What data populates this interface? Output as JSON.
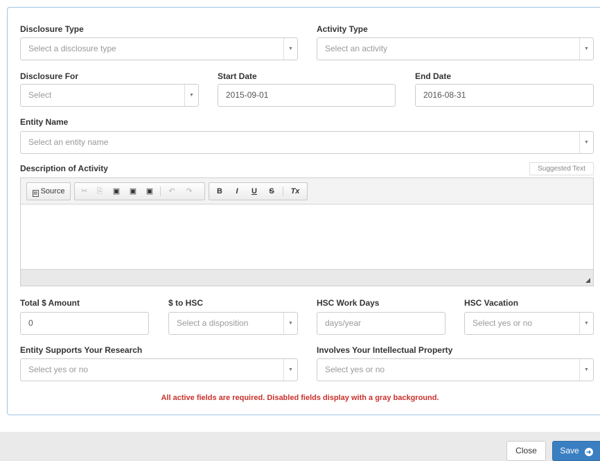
{
  "form": {
    "disclosure_type": {
      "label": "Disclosure Type",
      "placeholder": "Select a disclosure type"
    },
    "activity_type": {
      "label": "Activity Type",
      "placeholder": "Select an activity"
    },
    "disclosure_for": {
      "label": "Disclosure For",
      "placeholder": "Select"
    },
    "start_date": {
      "label": "Start Date",
      "value": "2015-09-01"
    },
    "end_date": {
      "label": "End Date",
      "value": "2016-08-31"
    },
    "entity_name": {
      "label": "Entity Name",
      "placeholder": "Select an entity name"
    },
    "description": {
      "label": "Description of Activity",
      "suggested_text": "Suggested Text"
    },
    "total_amount": {
      "label": "Total $ Amount",
      "value": "0"
    },
    "to_hsc": {
      "label": "$ to HSC",
      "placeholder": "Select a disposition"
    },
    "hsc_work_days": {
      "label": "HSC Work Days",
      "placeholder": "days/year"
    },
    "hsc_vacation": {
      "label": "HSC Vacation",
      "placeholder": "Select yes or no"
    },
    "entity_supports": {
      "label": "Entity Supports Your Research",
      "placeholder": "Select yes or no"
    },
    "intellectual_property": {
      "label": "Involves Your Intellectual Property",
      "placeholder": "Select yes or no"
    }
  },
  "editor": {
    "source_label": "Source",
    "bold": "B",
    "italic": "I",
    "underline": "U",
    "strike": "S",
    "clear_format": "Tx"
  },
  "note": "All active fields are required. Disabled fields display with a gray background.",
  "footer": {
    "close_label": "Close",
    "save_label": "Save"
  },
  "colors": {
    "accent": "#3a7fc1",
    "error_text": "#c9302c",
    "panel_border": "#9fc4e6"
  }
}
